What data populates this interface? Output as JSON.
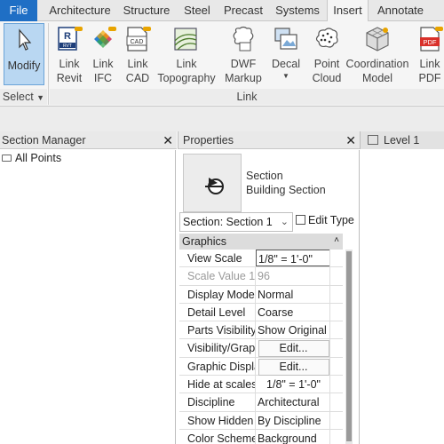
{
  "tabs": [
    "File",
    "Architecture",
    "Structure",
    "Steel",
    "Precast",
    "Systems",
    "Insert",
    "Annotate"
  ],
  "ribbon": {
    "modify_label": "Modify",
    "select_label": "Select",
    "link_group_label": "Link",
    "buttons": [
      {
        "label": "Link\nRevit",
        "icon": "link-revit-icon"
      },
      {
        "label": "Link\nIFC",
        "icon": "link-ifc-icon"
      },
      {
        "label": "Link\nCAD",
        "icon": "link-cad-icon"
      },
      {
        "label": "Link\nTopography",
        "icon": "link-topography-icon"
      },
      {
        "label": "DWF\nMarkup",
        "icon": "dwf-markup-icon"
      },
      {
        "label": "Decal",
        "icon": "decal-icon"
      },
      {
        "label": "Point\nCloud",
        "icon": "point-cloud-icon"
      },
      {
        "label": "Coordination\nModel",
        "icon": "coordination-model-icon"
      },
      {
        "label": "Link\nPDF",
        "icon": "link-pdf-icon"
      }
    ],
    "icon_badge_texts": {
      "rvt": "RVT",
      "cad": "CAD",
      "pdf": "PDF"
    }
  },
  "section_manager": {
    "title": "Section Manager",
    "items": [
      "All Points"
    ]
  },
  "properties": {
    "title": "Properties",
    "type_line1": "Section",
    "type_line2": "Building Section",
    "type_selector": "Section: Section 1",
    "edit_type_label": "Edit Type",
    "group": "Graphics",
    "rows": [
      {
        "key": "View Scale",
        "value": "1/8\" = 1'-0\"",
        "style": "boxed"
      },
      {
        "key": "Scale Value   1:",
        "value": "96",
        "style": "grey"
      },
      {
        "key": "Display Model",
        "value": "Normal",
        "style": ""
      },
      {
        "key": "Detail Level",
        "value": "Coarse",
        "style": ""
      },
      {
        "key": "Parts Visibility",
        "value": "Show Original",
        "style": ""
      },
      {
        "key": "Visibility/Graphics Overrides",
        "value": "Edit...",
        "style": "btn"
      },
      {
        "key": "Graphic Display Options",
        "value": "Edit...",
        "style": "btn"
      },
      {
        "key": "Hide at scales coarser than",
        "value": "1/8\" = 1'-0\"",
        "style": "center"
      },
      {
        "key": "Discipline",
        "value": "Architectural",
        "style": ""
      },
      {
        "key": "Show Hidden Lines",
        "value": "By Discipline",
        "style": ""
      },
      {
        "key": "Color Scheme Location",
        "value": "Background",
        "style": ""
      }
    ]
  },
  "view_tab": {
    "label": "Level 1"
  },
  "colors": {
    "file_tab": "#1f6fc5",
    "selected_tool": "#b9d7f2"
  }
}
